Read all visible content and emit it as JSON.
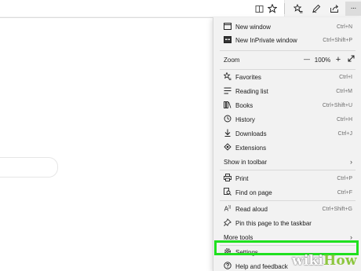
{
  "toolbar": {
    "icons": [
      "reading-view-icon",
      "favorite-star-icon",
      "favorites-hub-icon",
      "pen-notes-icon",
      "share-icon",
      "more-icon"
    ],
    "more_label": "···"
  },
  "menu": {
    "items": [
      {
        "label": "New window",
        "shortcut": "Ctrl+N",
        "icon": "new-window-icon"
      },
      {
        "label": "New InPrivate window",
        "shortcut": "Ctrl+Shift+P",
        "icon": "inprivate-icon"
      },
      {
        "label": "Favorites",
        "shortcut": "Ctrl+I",
        "icon": "favorites-icon"
      },
      {
        "label": "Reading list",
        "shortcut": "Ctrl+M",
        "icon": "reading-list-icon"
      },
      {
        "label": "Books",
        "shortcut": "Ctrl+Shift+U",
        "icon": "books-icon"
      },
      {
        "label": "History",
        "shortcut": "Ctrl+H",
        "icon": "history-icon"
      },
      {
        "label": "Downloads",
        "shortcut": "Ctrl+J",
        "icon": "downloads-icon"
      },
      {
        "label": "Extensions",
        "shortcut": "",
        "icon": "extensions-icon"
      },
      {
        "label": "Show in toolbar",
        "shortcut": "",
        "icon": ""
      },
      {
        "label": "Print",
        "shortcut": "Ctrl+P",
        "icon": "print-icon"
      },
      {
        "label": "Find on page",
        "shortcut": "Ctrl+F",
        "icon": "find-icon"
      },
      {
        "label": "Read aloud",
        "shortcut": "Ctrl+Shift+G",
        "icon": "read-aloud-icon"
      },
      {
        "label": "Pin this page to the taskbar",
        "shortcut": "",
        "icon": "pin-icon"
      },
      {
        "label": "More tools",
        "shortcut": "",
        "icon": ""
      },
      {
        "label": "Settings",
        "shortcut": "",
        "icon": "settings-icon"
      },
      {
        "label": "Help and feedback",
        "shortcut": "",
        "icon": "help-icon"
      }
    ],
    "zoom": {
      "label": "Zoom",
      "value": "100%",
      "minus": "—",
      "plus": "+"
    }
  },
  "watermark": {
    "part1": "wiki",
    "part2": "How"
  },
  "colors": {
    "highlight": "#1fe01f",
    "menu_bg": "#f2f2f2",
    "watermark_green": "#8dc63f"
  }
}
